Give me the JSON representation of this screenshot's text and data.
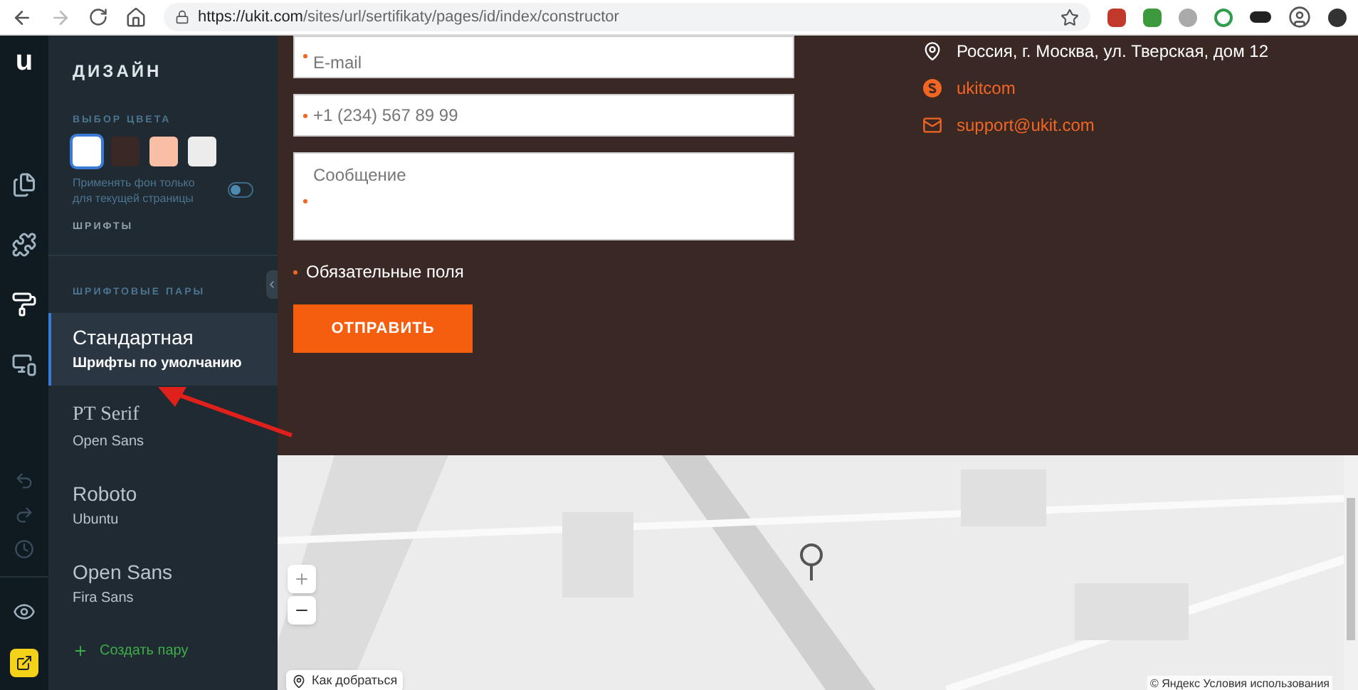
{
  "browser": {
    "url_host": "https://ukit.com",
    "url_path": "/sites/url/sertifikaty/pages/id/index/constructor"
  },
  "rail": {
    "logo": "u",
    "items": [
      {
        "kind": "pages",
        "selected": false
      },
      {
        "kind": "plugins",
        "selected": false
      },
      {
        "kind": "design",
        "selected": true
      },
      {
        "kind": "devices",
        "selected": false
      }
    ]
  },
  "sidebar": {
    "title": "ДИЗАЙН",
    "color_label": "ВЫБОР ЦВЕТА",
    "swatches": [
      {
        "color": "#ffffff",
        "selected": true
      },
      {
        "color": "#3a2824",
        "selected": false
      },
      {
        "color": "#f9bfa4",
        "selected": false
      },
      {
        "color": "#ececec",
        "selected": false
      }
    ],
    "toggle": {
      "label": "Применять фон только для текущей страницы",
      "on": false
    },
    "fonts_label": "ШРИФТЫ",
    "pairs_label": "ШРИФТОВЫЕ ПАРЫ",
    "font_pairs": [
      {
        "title": "Стандартная",
        "subtitle": "Шрифты по умолчанию",
        "selected": true
      },
      {
        "title": "PT Serif",
        "subtitle": "Open Sans",
        "selected": false
      },
      {
        "title": "Roboto",
        "subtitle": "Ubuntu",
        "selected": false
      },
      {
        "title": "Open Sans",
        "subtitle": "Fira Sans",
        "selected": false
      }
    ],
    "create_pair": "Создать пару"
  },
  "form": {
    "fields": [
      {
        "kind": "input",
        "placeholder": "E-mail",
        "required": true
      },
      {
        "kind": "input",
        "placeholder": "+1 (234) 567 89 99",
        "required": true
      },
      {
        "kind": "textarea",
        "placeholder": "Сообщение",
        "required": true
      }
    ],
    "required_note": "Обязательные поля",
    "submit": "ОТПРАВИТЬ"
  },
  "contacts": [
    {
      "kind": "address",
      "text": "Россия, г. Москва, ул. Тверская, дом 12"
    },
    {
      "kind": "skype",
      "text": "ukitcom"
    },
    {
      "kind": "email",
      "text": "support@ukit.com"
    }
  ],
  "map": {
    "route_button": "Как добраться",
    "copyright": "© Яндекс Условия использования"
  }
}
